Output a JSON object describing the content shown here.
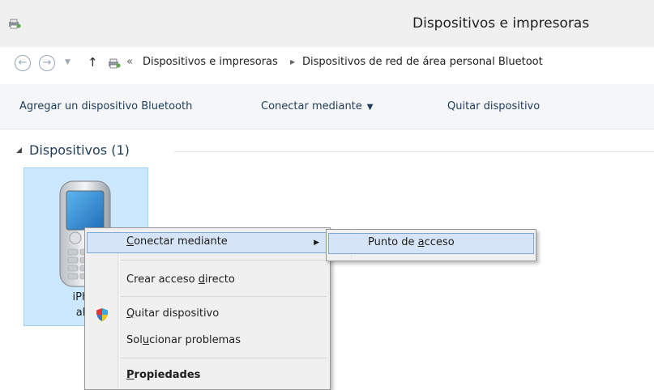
{
  "window": {
    "title": "Dispositivos e impresoras",
    "icon": "devices-printers-icon"
  },
  "address_bar": {
    "back_icon": "back-arrow-icon",
    "forward_icon": "forward-arrow-icon",
    "recent_icon": "chevron-down-icon",
    "up_icon": "up-arrow-icon",
    "overflow": "«",
    "breadcrumbs": [
      "Dispositivos e impresoras",
      "Dispositivos de red de área personal Bluetoot"
    ]
  },
  "command_bar": {
    "items": [
      "Agregar un dispositivo Bluetooth",
      "Conectar mediante",
      "Quitar dispositivo"
    ]
  },
  "group": {
    "title": "Dispositivos (1)"
  },
  "device": {
    "name_line1": "iPhor",
    "name_line2": "ahu",
    "icon": "mobile-phone-icon"
  },
  "context_menu": {
    "items": [
      {
        "label": "Conectar mediante",
        "accel": "C"
      },
      {
        "label": "Crear acceso directo",
        "accel": "d"
      },
      {
        "label": "Quitar dispositivo",
        "accel": "Q"
      },
      {
        "label": "Solucionar problemas",
        "accel": "u"
      },
      {
        "label": "Propiedades",
        "accel": "P"
      }
    ]
  },
  "submenu": {
    "items": [
      {
        "label": "Punto de acceso",
        "accel": "a"
      }
    ]
  },
  "colors": {
    "accent": "#1e3c5a",
    "selection": "#cce8ff",
    "menu_highlight": "#d5e4f6"
  }
}
